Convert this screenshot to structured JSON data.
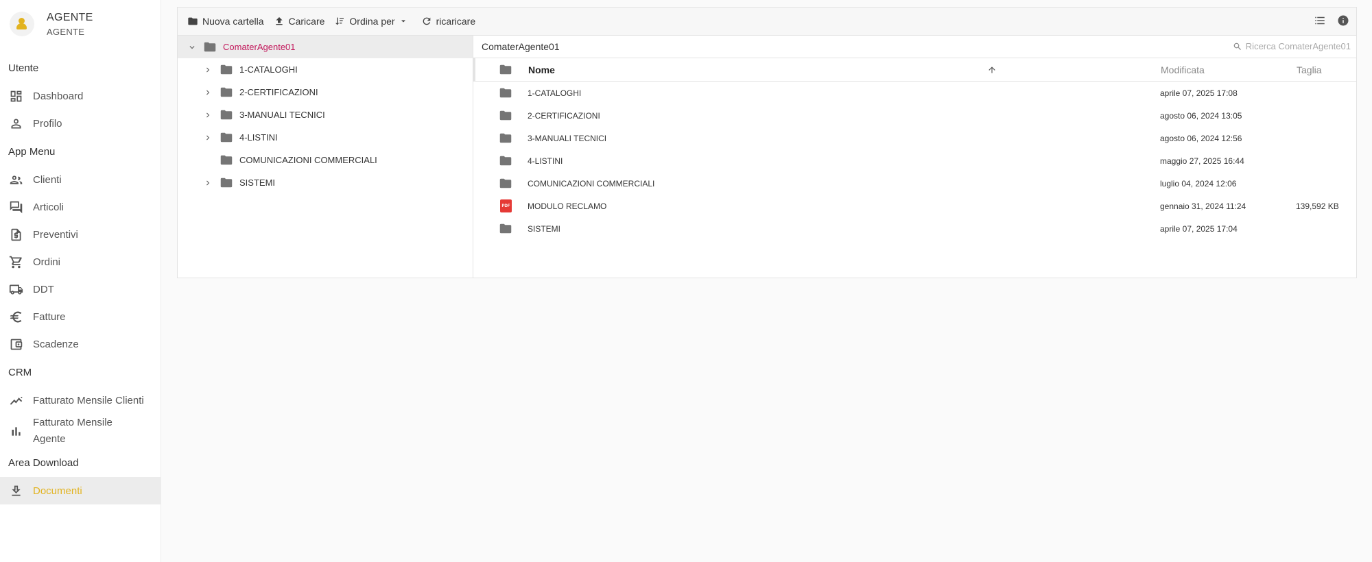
{
  "user": {
    "name": "AGENTE",
    "role": "AGENTE"
  },
  "sidebar": {
    "sections": [
      {
        "title": "Utente",
        "items": [
          {
            "label": "Dashboard",
            "icon": "dashboard-icon"
          },
          {
            "label": "Profilo",
            "icon": "person-icon"
          }
        ]
      },
      {
        "title": "App Menu",
        "items": [
          {
            "label": "Clienti",
            "icon": "people-icon"
          },
          {
            "label": "Articoli",
            "icon": "chat-icon"
          },
          {
            "label": "Preventivi",
            "icon": "quote-icon"
          },
          {
            "label": "Ordini",
            "icon": "cart-icon"
          },
          {
            "label": "DDT",
            "icon": "truck-icon"
          },
          {
            "label": "Fatture",
            "icon": "euro-icon"
          },
          {
            "label": "Scadenze",
            "icon": "wallet-icon"
          }
        ]
      },
      {
        "title": "CRM",
        "items": [
          {
            "label": "Fatturato Mensile Clienti",
            "icon": "trend-icon"
          },
          {
            "label": "Fatturato Mensile Agente",
            "icon": "bar-chart-icon"
          }
        ]
      },
      {
        "title": "Area Download",
        "items": [
          {
            "label": "Documenti",
            "icon": "download-icon",
            "active": true
          }
        ]
      }
    ]
  },
  "toolbar": {
    "new_folder": "Nuova cartella",
    "upload": "Caricare",
    "sort_by": "Ordina per",
    "reload": "ricaricare"
  },
  "tree": {
    "root": "ComaterAgente01",
    "children": [
      {
        "label": "1-CATALOGHI",
        "expandable": true
      },
      {
        "label": "2-CERTIFICAZIONI",
        "expandable": true
      },
      {
        "label": "3-MANUALI TECNICI",
        "expandable": true
      },
      {
        "label": "4-LISTINI",
        "expandable": true
      },
      {
        "label": "COMUNICAZIONI COMMERCIALI",
        "expandable": false
      },
      {
        "label": "SISTEMI",
        "expandable": true
      }
    ]
  },
  "breadcrumb": "ComaterAgente01",
  "search": {
    "placeholder": "Ricerca ComaterAgente01"
  },
  "grid": {
    "headers": {
      "name": "Nome",
      "modified": "Modificata",
      "size": "Taglia"
    },
    "rows": [
      {
        "name": "1-CATALOGHI",
        "modified": "aprile 07, 2025 17:08",
        "size": "",
        "type": "folder"
      },
      {
        "name": "2-CERTIFICAZIONI",
        "modified": "agosto 06, 2024 13:05",
        "size": "",
        "type": "folder"
      },
      {
        "name": "3-MANUALI TECNICI",
        "modified": "agosto 06, 2024 12:56",
        "size": "",
        "type": "folder"
      },
      {
        "name": "4-LISTINI",
        "modified": "maggio 27, 2025 16:44",
        "size": "",
        "type": "folder"
      },
      {
        "name": "COMUNICAZIONI COMMERCIALI",
        "modified": "luglio 04, 2024 12:06",
        "size": "",
        "type": "folder"
      },
      {
        "name": "MODULO RECLAMO",
        "modified": "gennaio 31, 2024 11:24",
        "size": "139,592 KB",
        "type": "pdf",
        "badge": "PDF"
      },
      {
        "name": "SISTEMI",
        "modified": "aprile 07, 2025 17:04",
        "size": "",
        "type": "folder"
      }
    ]
  },
  "colors": {
    "accent": "#e2b320",
    "tree_selected": "#c2185b",
    "pdf": "#e53935",
    "folder": "#757575"
  }
}
